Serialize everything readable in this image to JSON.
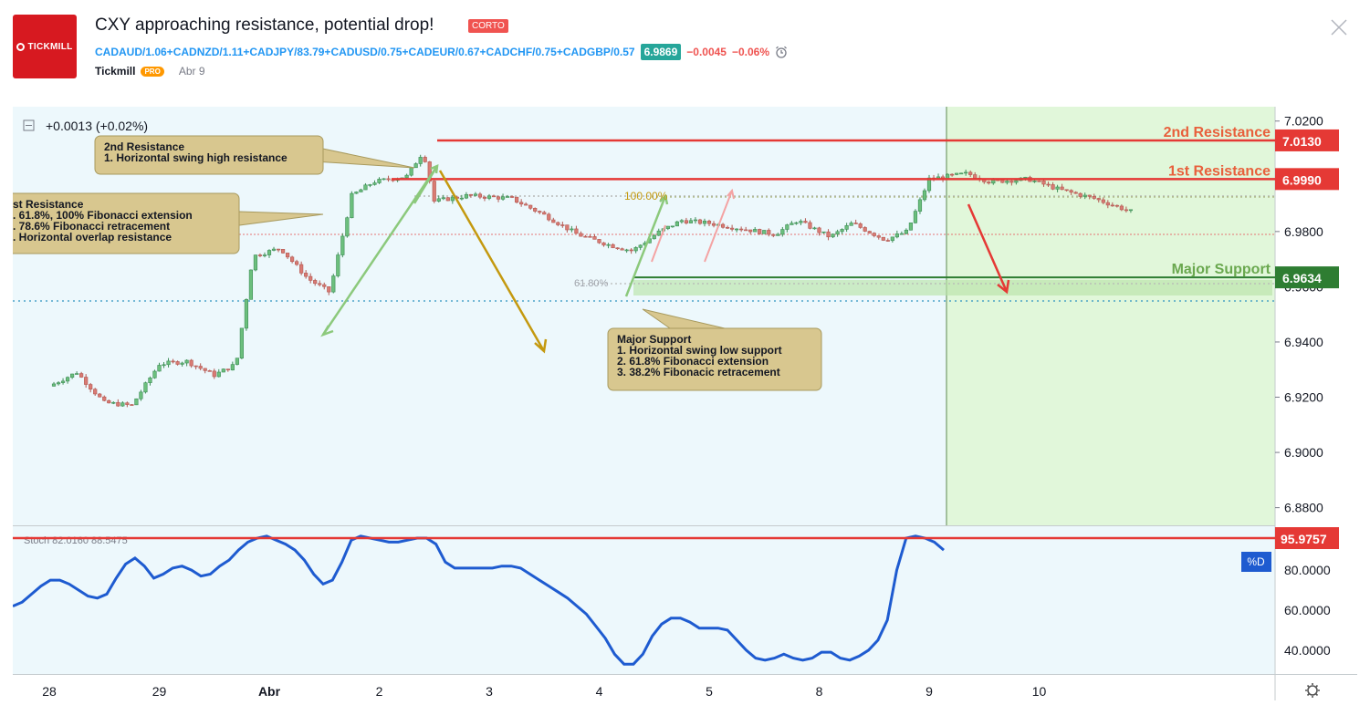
{
  "header": {
    "logo_text": "TICKMILL",
    "title": "CXY approaching resistance, potential drop!",
    "badge": "CORTO",
    "symbol": "CADAUD/1.06+CADNZD/1.11+CADJPY/83.79+CADUSD/0.75+CADEUR/0.67+CADCHF/0.75+CADGBP/0.57",
    "price": "6.9869",
    "change": "−0.0045",
    "change_pct": "−0.06%",
    "author": "Tickmill",
    "author_badge": "PRO",
    "date": "Abr 9",
    "icons": [
      "alarm-clock-icon",
      "close-icon",
      "collapse-icon",
      "gear-icon"
    ]
  },
  "legend": {
    "change_text": "+0.0013 (+0.02%)",
    "stoch_text": "Stoch  82.0160  88.5475",
    "stoch_label": "%D"
  },
  "chart_data": {
    "type": "candlestick",
    "symbol": "CXY",
    "x_tick_labels": [
      "28",
      "29",
      "Abr",
      "2",
      "3",
      "4",
      "5",
      "8",
      "9",
      "10"
    ],
    "y_ticks": [
      "7.0200",
      "7.0000",
      "6.9800",
      "6.9600",
      "6.9400",
      "6.9200",
      "6.9000",
      "6.8800"
    ],
    "ylim": [
      6.8736,
      7.0252
    ],
    "close_path": [
      {
        "day": 0.0,
        "price": 6.924
      },
      {
        "day": 0.25,
        "price": 6.929
      },
      {
        "day": 0.5,
        "price": 6.918
      },
      {
        "day": 0.75,
        "price": 6.917
      },
      {
        "day": 1.0,
        "price": 6.932
      },
      {
        "day": 1.25,
        "price": 6.933
      },
      {
        "day": 1.5,
        "price": 6.928
      },
      {
        "day": 1.7,
        "price": 6.932
      },
      {
        "day": 1.85,
        "price": 6.971
      },
      {
        "day": 2.1,
        "price": 6.974
      },
      {
        "day": 2.35,
        "price": 6.963
      },
      {
        "day": 2.55,
        "price": 6.958
      },
      {
        "day": 2.75,
        "price": 6.993
      },
      {
        "day": 2.95,
        "price": 6.998
      },
      {
        "day": 3.25,
        "price": 7.0
      },
      {
        "day": 3.4,
        "price": 7.009
      },
      {
        "day": 3.5,
        "price": 6.991
      },
      {
        "day": 3.8,
        "price": 6.993
      },
      {
        "day": 4.2,
        "price": 6.992
      },
      {
        "day": 4.5,
        "price": 6.986
      },
      {
        "day": 4.8,
        "price": 6.979
      },
      {
        "day": 5.1,
        "price": 6.975
      },
      {
        "day": 5.3,
        "price": 6.973
      },
      {
        "day": 5.55,
        "price": 6.98
      },
      {
        "day": 5.75,
        "price": 6.984
      },
      {
        "day": 6.0,
        "price": 6.983
      },
      {
        "day": 6.3,
        "price": 6.981
      },
      {
        "day": 6.6,
        "price": 6.979
      },
      {
        "day": 6.8,
        "price": 6.984
      },
      {
        "day": 7.1,
        "price": 6.978
      },
      {
        "day": 7.3,
        "price": 6.983
      },
      {
        "day": 7.6,
        "price": 6.977
      },
      {
        "day": 7.8,
        "price": 6.98
      },
      {
        "day": 8.0,
        "price": 6.999
      },
      {
        "day": 8.35,
        "price": 7.001
      },
      {
        "day": 8.55,
        "price": 6.998
      },
      {
        "day": 8.9,
        "price": 6.999
      },
      {
        "day": 9.2,
        "price": 6.995
      },
      {
        "day": 9.5,
        "price": 6.992
      },
      {
        "day": 9.85,
        "price": 6.987
      }
    ],
    "levels": [
      {
        "name": "2nd Resistance",
        "value": 7.013,
        "label": "7.0130",
        "color": "#e53935"
      },
      {
        "name": "1st Resistance",
        "value": 6.999,
        "label": "6.9990",
        "color": "#e53935"
      },
      {
        "name": "Major Support",
        "value": 6.9634,
        "label": "6.9634",
        "color": "#2e7d32"
      }
    ],
    "fib_labels": [
      "100.00%",
      "61.80%"
    ],
    "annotations": [
      {
        "title": "2nd Resistance",
        "lines": [
          "1. Horizontal swing high resistance"
        ]
      },
      {
        "title": "st Resistance",
        "lines": [
          ". 61.8%, 100% Fibonacci extension",
          ". 78.6% Fibonacci retracement",
          ". Horizontal overlap resistance"
        ]
      },
      {
        "title": "Major Support",
        "lines": [
          "1. Horizontal swing low support",
          "2. 61.8% Fibonacci extension",
          "3. 38.2% Fibonacic retracement"
        ]
      }
    ],
    "stochastic": {
      "y_ticks": [
        "80.0000",
        "60.0000",
        "40.0000"
      ],
      "ylim": [
        29,
        101
      ],
      "level": 95.9757,
      "level_label": "95.9757",
      "values": [
        62,
        64,
        68,
        72,
        75,
        75,
        73,
        70,
        67,
        66,
        68,
        76,
        83,
        86,
        82,
        76,
        78,
        81,
        82,
        80,
        77,
        78,
        82,
        85,
        90,
        94,
        96,
        97,
        95,
        93,
        90,
        85,
        78,
        73,
        75,
        84,
        95,
        97,
        96,
        95,
        94,
        94,
        95,
        96,
        96,
        93,
        84,
        81,
        81,
        81,
        81,
        81,
        82,
        82,
        81,
        78,
        75,
        72,
        69,
        66,
        62,
        58,
        52,
        46,
        38,
        33,
        33,
        38,
        47,
        53,
        56,
        56,
        54,
        51,
        51,
        51,
        50,
        45,
        40,
        36,
        35,
        36,
        38,
        36,
        35,
        36,
        39,
        39,
        36,
        35,
        37,
        40,
        45,
        55,
        80,
        96,
        97,
        96,
        94,
        90
      ]
    }
  }
}
